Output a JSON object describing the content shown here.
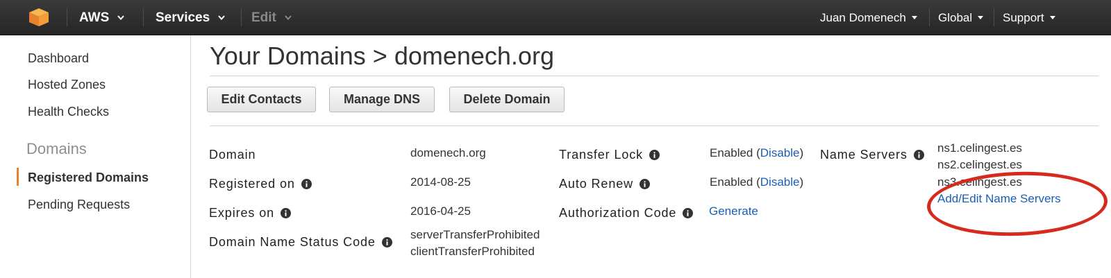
{
  "topbar": {
    "logo_icon": "aws-cube-icon",
    "aws_label": "AWS",
    "services_label": "Services",
    "edit_label": "Edit",
    "user_label": "Juan Domenech",
    "region_label": "Global",
    "support_label": "Support"
  },
  "sidebar": {
    "items": [
      {
        "label": "Dashboard"
      },
      {
        "label": "Hosted Zones"
      },
      {
        "label": "Health Checks"
      }
    ],
    "section_heading": "Domains",
    "domain_items": [
      {
        "label": "Registered Domains",
        "active": true
      },
      {
        "label": "Pending Requests",
        "active": false
      }
    ]
  },
  "main": {
    "title": "Your Domains > domenech.org",
    "buttons": {
      "edit_contacts": "Edit Contacts",
      "manage_dns": "Manage DNS",
      "delete_domain": "Delete Domain"
    },
    "details": {
      "domain_label": "Domain",
      "domain_value": "domenech.org",
      "registered_label": "Registered on",
      "registered_value": "2014-08-25",
      "expires_label": "Expires on",
      "expires_value": "2016-04-25",
      "status_label": "Domain Name Status Code",
      "status_values": [
        "serverTransferProhibited",
        "clientTransferProhibited"
      ],
      "transfer_lock_label": "Transfer Lock",
      "transfer_lock_status": "Enabled",
      "transfer_lock_action": "Disable",
      "auto_renew_label": "Auto Renew",
      "auto_renew_status": "Enabled",
      "auto_renew_action": "Disable",
      "auth_code_label": "Authorization Code",
      "auth_code_action": "Generate",
      "name_servers_label": "Name Servers",
      "name_servers": [
        "ns1.celingest.es",
        "ns2.celingest.es",
        "ns3.celingest.es"
      ],
      "edit_name_servers_link": "Add/Edit Name Servers"
    }
  },
  "annotation": {
    "color": "#d72a1e"
  },
  "colors": {
    "accent": "#e9822d",
    "link": "#1a5fb4",
    "topbar": "#2f2f2f"
  }
}
